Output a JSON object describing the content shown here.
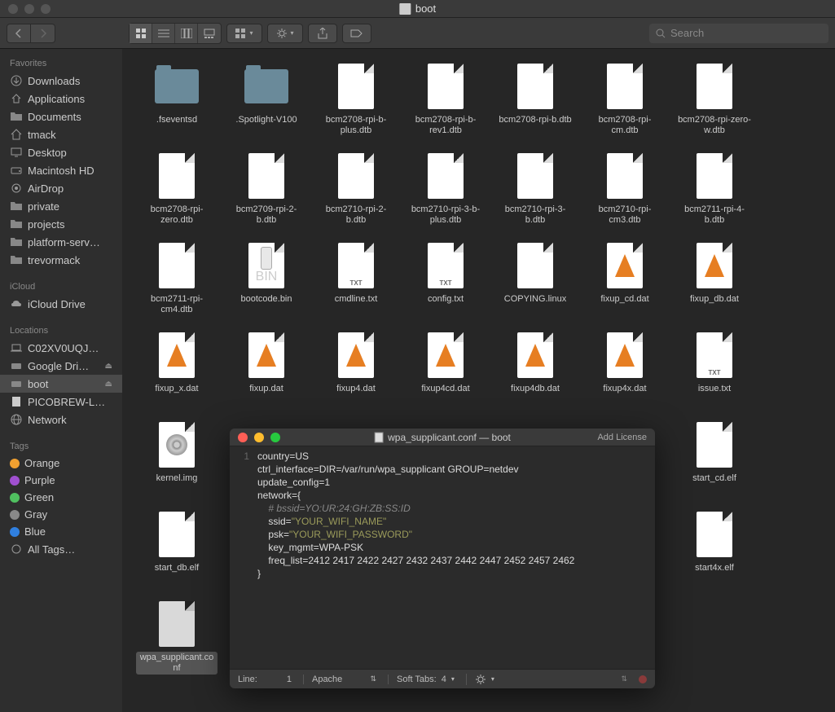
{
  "finder": {
    "title": "boot",
    "search_placeholder": "Search",
    "sidebar": {
      "favorites": {
        "header": "Favorites",
        "items": [
          {
            "icon": "download",
            "label": "Downloads"
          },
          {
            "icon": "apps",
            "label": "Applications"
          },
          {
            "icon": "folder",
            "label": "Documents"
          },
          {
            "icon": "home",
            "label": "tmack"
          },
          {
            "icon": "desktop",
            "label": "Desktop"
          },
          {
            "icon": "disk",
            "label": "Macintosh HD"
          },
          {
            "icon": "airdrop",
            "label": "AirDrop"
          },
          {
            "icon": "folder",
            "label": "private"
          },
          {
            "icon": "folder",
            "label": "projects"
          },
          {
            "icon": "folder",
            "label": "platform-serv…"
          },
          {
            "icon": "folder",
            "label": "trevormack"
          }
        ]
      },
      "icloud": {
        "header": "iCloud",
        "items": [
          {
            "icon": "cloud",
            "label": "iCloud Drive"
          }
        ]
      },
      "locations": {
        "header": "Locations",
        "items": [
          {
            "icon": "laptop",
            "label": "C02XV0UQJ…",
            "eject": false
          },
          {
            "icon": "drive",
            "label": "Google Dri…",
            "eject": true
          },
          {
            "icon": "drive",
            "label": "boot",
            "eject": true,
            "selected": true
          },
          {
            "icon": "doc",
            "label": "PICOBREW-L…",
            "eject": false
          },
          {
            "icon": "globe",
            "label": "Network",
            "eject": false
          }
        ]
      },
      "tags": {
        "header": "Tags",
        "items": [
          {
            "color": "#f0a030",
            "label": "Orange"
          },
          {
            "color": "#a050d0",
            "label": "Purple"
          },
          {
            "color": "#50c060",
            "label": "Green"
          },
          {
            "color": "#888888",
            "label": "Gray"
          },
          {
            "color": "#3080e0",
            "label": "Blue"
          }
        ],
        "all_tags": "All Tags…"
      }
    },
    "files": [
      {
        "type": "folder",
        "name": ".fseventsd"
      },
      {
        "type": "folder",
        "name": ".Spotlight-V100"
      },
      {
        "type": "file",
        "name": "bcm2708-rpi-b-plus.dtb"
      },
      {
        "type": "file",
        "name": "bcm2708-rpi-b-rev1.dtb"
      },
      {
        "type": "file",
        "name": "bcm2708-rpi-b.dtb"
      },
      {
        "type": "file",
        "name": "bcm2708-rpi-cm.dtb"
      },
      {
        "type": "file",
        "name": "bcm2708-rpi-zero-w.dtb"
      },
      {
        "type": "file",
        "name": "bcm2708-rpi-zero.dtb"
      },
      {
        "type": "file",
        "name": "bcm2709-rpi-2-b.dtb"
      },
      {
        "type": "file",
        "name": "bcm2710-rpi-2-b.dtb"
      },
      {
        "type": "file",
        "name": "bcm2710-rpi-3-b-plus.dtb"
      },
      {
        "type": "file",
        "name": "bcm2710-rpi-3-b.dtb"
      },
      {
        "type": "file",
        "name": "bcm2710-rpi-cm3.dtb"
      },
      {
        "type": "file",
        "name": "bcm2711-rpi-4-b.dtb"
      },
      {
        "type": "file",
        "name": "bcm2711-rpi-cm4.dtb"
      },
      {
        "type": "bin",
        "name": "bootcode.bin",
        "badge": "BIN"
      },
      {
        "type": "txt",
        "name": "cmdline.txt",
        "badge": "TXT"
      },
      {
        "type": "txt",
        "name": "config.txt",
        "badge": "TXT"
      },
      {
        "type": "file",
        "name": "COPYING.linux"
      },
      {
        "type": "vlc",
        "name": "fixup_cd.dat"
      },
      {
        "type": "vlc",
        "name": "fixup_db.dat"
      },
      {
        "type": "vlc",
        "name": "fixup_x.dat"
      },
      {
        "type": "vlc",
        "name": "fixup.dat"
      },
      {
        "type": "vlc",
        "name": "fixup4.dat"
      },
      {
        "type": "vlc",
        "name": "fixup4cd.dat"
      },
      {
        "type": "vlc",
        "name": "fixup4db.dat"
      },
      {
        "type": "vlc",
        "name": "fixup4x.dat"
      },
      {
        "type": "txt",
        "name": "issue.txt",
        "badge": "TXT"
      },
      {
        "type": "disk",
        "name": "kernel.img"
      },
      {
        "type": "hidden",
        "name": ""
      },
      {
        "type": "hidden",
        "name": ""
      },
      {
        "type": "hidden",
        "name": ""
      },
      {
        "type": "hidden",
        "name": ""
      },
      {
        "type": "hidden",
        "name": ""
      },
      {
        "type": "file",
        "name": "start_cd.elf"
      },
      {
        "type": "file",
        "name": "start_db.elf"
      },
      {
        "type": "hidden",
        "name": ""
      },
      {
        "type": "hidden",
        "name": ""
      },
      {
        "type": "hidden",
        "name": ""
      },
      {
        "type": "hidden",
        "name": ""
      },
      {
        "type": "hidden",
        "name": ""
      },
      {
        "type": "file",
        "name": "start4x.elf"
      },
      {
        "type": "file",
        "name": "wpa_supplicant.conf",
        "selected": true
      }
    ]
  },
  "editor": {
    "title": "wpa_supplicant.conf — boot",
    "add_license": "Add License",
    "code_lines": [
      {
        "t": "country=US",
        "c": "kw"
      },
      {
        "t": "ctrl_interface=DIR=/var/run/wpa_supplicant GROUP=netdev",
        "c": "kw"
      },
      {
        "t": "update_config=1",
        "c": "kw"
      },
      {
        "t": "",
        "c": ""
      },
      {
        "t": "network={",
        "c": "kw"
      },
      {
        "t": "    # bssid=YO:UR:24:GH:ZB:SS:ID",
        "c": "cm"
      },
      {
        "t": "    ssid=\"YOUR_WIFI_NAME\"",
        "c": "str"
      },
      {
        "t": "    psk=\"YOUR_WIFI_PASSWORD\"",
        "c": "str"
      },
      {
        "t": "    key_mgmt=WPA-PSK",
        "c": "kw"
      },
      {
        "t": "    freq_list=2412 2417 2422 2427 2432 2437 2442 2447 2452 2457 2462",
        "c": "kw"
      },
      {
        "t": "}",
        "c": "kw"
      }
    ],
    "status": {
      "line_label": "Line:",
      "line_value": "1",
      "syntax": "Apache",
      "tabs_label": "Soft Tabs:",
      "tabs_value": "4"
    }
  }
}
